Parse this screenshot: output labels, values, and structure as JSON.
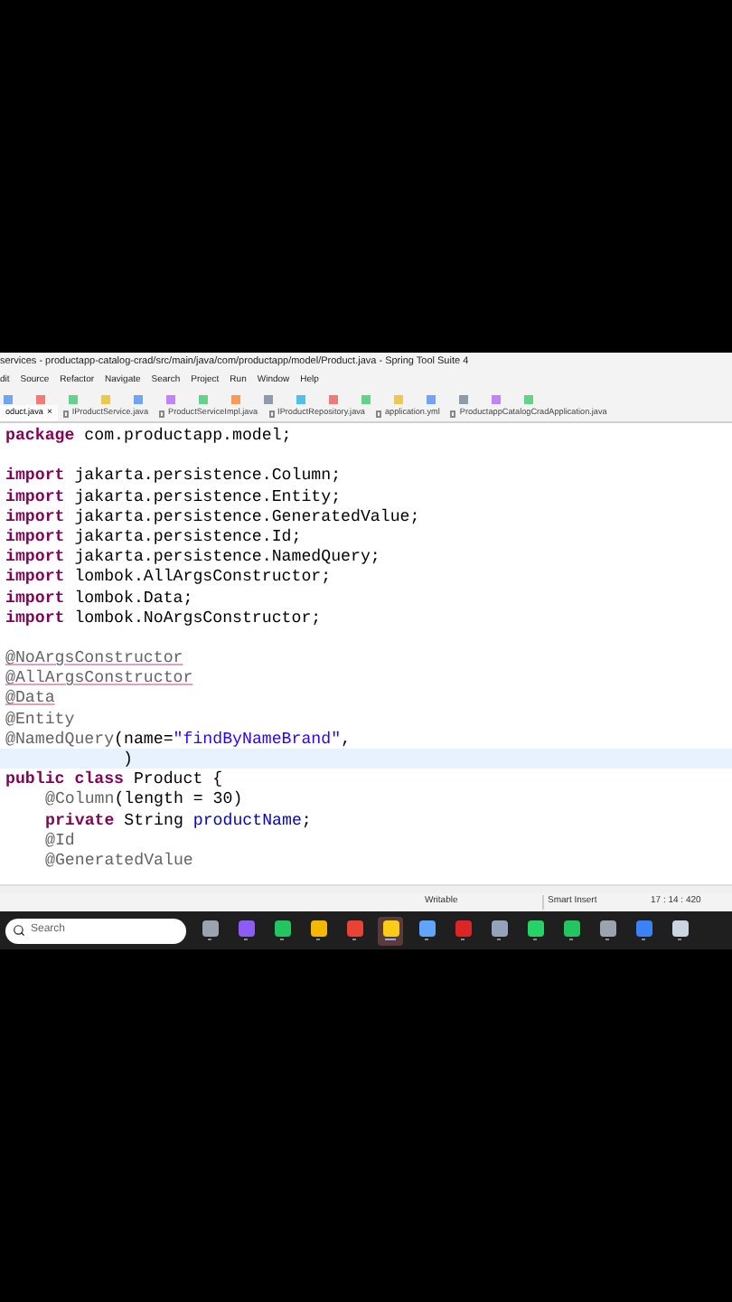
{
  "window": {
    "title": "services - productapp-catalog-crad/src/main/java/com/productapp/model/Product.java - Spring Tool Suite 4"
  },
  "menu": [
    "dit",
    "Source",
    "Refactor",
    "Navigate",
    "Search",
    "Project",
    "Run",
    "Window",
    "Help"
  ],
  "tabs": [
    {
      "label": "oduct.java",
      "selected": true,
      "close": "×"
    },
    {
      "label": "IProductService.java",
      "selected": false
    },
    {
      "label": "ProductServiceImpl.java",
      "selected": false
    },
    {
      "label": "IProductRepository.java",
      "selected": false
    },
    {
      "label": "application.yml",
      "selected": false
    },
    {
      "label": "ProductappCatalogCradApplication.java",
      "selected": false
    }
  ],
  "editor": {
    "lines": [
      {
        "current": false,
        "tokens": [
          {
            "kind": "keyword",
            "text": "package"
          },
          {
            "kind": "plain",
            "text": " com.productapp.model;"
          }
        ]
      },
      {
        "current": false
      },
      {
        "current": false,
        "tokens": [
          {
            "kind": "keyword",
            "text": "import"
          },
          {
            "kind": "plain",
            "text": " jakarta.persistence.Column;"
          }
        ]
      },
      {
        "current": false,
        "tokens": [
          {
            "kind": "keyword",
            "text": "import"
          },
          {
            "kind": "plain",
            "text": " jakarta.persistence.Entity;"
          }
        ]
      },
      {
        "current": false,
        "tokens": [
          {
            "kind": "keyword",
            "text": "import"
          },
          {
            "kind": "plain",
            "text": " jakarta.persistence.GeneratedValue;"
          }
        ]
      },
      {
        "current": false,
        "tokens": [
          {
            "kind": "keyword",
            "text": "import"
          },
          {
            "kind": "plain",
            "text": " jakarta.persistence.Id;"
          }
        ]
      },
      {
        "current": false,
        "tokens": [
          {
            "kind": "keyword",
            "text": "import"
          },
          {
            "kind": "plain",
            "text": " jakarta.persistence.NamedQuery;"
          }
        ]
      },
      {
        "current": false,
        "tokens": [
          {
            "kind": "keyword",
            "text": "import"
          },
          {
            "kind": "plain",
            "text": " lombok.AllArgsConstructor;"
          }
        ]
      },
      {
        "current": false,
        "tokens": [
          {
            "kind": "keyword",
            "text": "import"
          },
          {
            "kind": "plain",
            "text": " lombok.Data;"
          }
        ]
      },
      {
        "current": false,
        "tokens": [
          {
            "kind": "keyword",
            "text": "import"
          },
          {
            "kind": "plain",
            "text": " lombok.NoArgsConstructor;"
          }
        ]
      },
      {
        "current": false
      },
      {
        "current": false,
        "tokens": [
          {
            "kind": "annotation",
            "text": "@NoArgsConstructor",
            "warning": true
          }
        ]
      },
      {
        "current": false,
        "tokens": [
          {
            "kind": "annotation",
            "text": "@AllArgsConstructor",
            "warning": true
          }
        ]
      },
      {
        "current": false,
        "tokens": [
          {
            "kind": "annotation",
            "text": "@Data",
            "warning": true
          }
        ]
      },
      {
        "current": false,
        "tokens": [
          {
            "kind": "annotation",
            "text": "@Entity"
          }
        ]
      },
      {
        "current": false,
        "tokens": [
          {
            "kind": "annotation",
            "text": "@NamedQuery"
          },
          {
            "kind": "plain",
            "text": "(name="
          },
          {
            "kind": "string",
            "text": "\"findByNameBrand\""
          },
          {
            "kind": "plain",
            "text": ","
          }
        ]
      },
      {
        "current": true,
        "continuation": true,
        "tokens": [
          {
            "kind": "plain",
            "text": ")"
          }
        ]
      },
      {
        "current": false,
        "tokens": [
          {
            "kind": "keyword",
            "text": "public class"
          },
          {
            "kind": "plain",
            "text": " Product {"
          }
        ]
      },
      {
        "current": false,
        "indented": true,
        "tokens": [
          {
            "kind": "annotation",
            "text": "@Column"
          },
          {
            "kind": "plain",
            "text": "(length = 30)"
          }
        ]
      },
      {
        "current": false,
        "indented": true,
        "tokens": [
          {
            "kind": "keyword",
            "text": "private"
          },
          {
            "kind": "plain",
            "text": " String "
          },
          {
            "kind": "field",
            "text": "productName"
          },
          {
            "kind": "plain",
            "text": ";"
          }
        ]
      },
      {
        "current": false,
        "indented": true,
        "tokens": [
          {
            "kind": "annotation",
            "text": "@Id"
          }
        ]
      },
      {
        "current": false,
        "indented": true,
        "tokens": [
          {
            "kind": "annotation",
            "text": "@GeneratedValue"
          }
        ]
      }
    ]
  },
  "status_bar": {
    "mode": "Writable",
    "insert": "Smart Insert",
    "position": "17 : 14 : 420"
  },
  "taskbar": {
    "search": {
      "placeholder": "Search"
    },
    "apps": [
      {
        "active": false
      },
      {
        "active": false
      },
      {
        "active": false
      },
      {
        "active": false
      },
      {
        "active": false
      },
      {
        "active": true
      },
      {
        "active": false
      },
      {
        "active": false
      },
      {
        "active": false
      },
      {
        "active": false
      },
      {
        "active": false
      },
      {
        "active": false
      },
      {
        "active": false
      },
      {
        "active": false
      }
    ]
  }
}
